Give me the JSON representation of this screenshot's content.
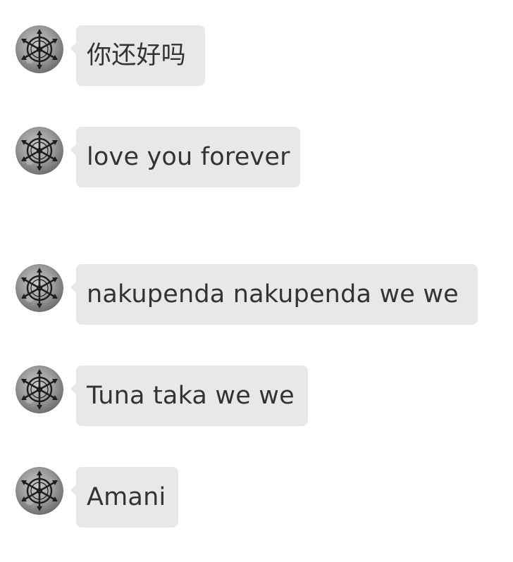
{
  "conversation": {
    "messages": [
      {
        "text": "你还好吗",
        "avatar_icon": "occult-sigil-icon"
      },
      {
        "text": "love you forever",
        "avatar_icon": "occult-sigil-icon"
      },
      {
        "text": "nakupenda nakupenda we we",
        "avatar_icon": "occult-sigil-icon"
      },
      {
        "text": "Tuna taka we we",
        "avatar_icon": "occult-sigil-icon"
      },
      {
        "text": "Amani",
        "avatar_icon": "occult-sigil-icon"
      }
    ]
  },
  "colors": {
    "background": "#ffffff",
    "bubble": "#e8e8e8",
    "text": "#333333",
    "avatar_bg": "#9a9a9a",
    "avatar_sigil": "#1e1e1e"
  }
}
